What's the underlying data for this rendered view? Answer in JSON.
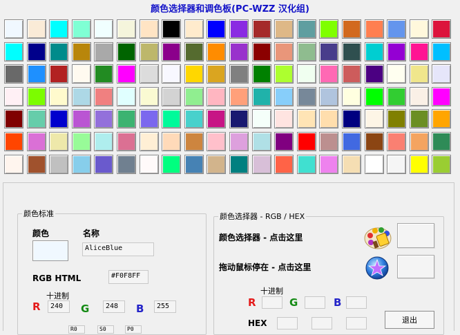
{
  "title": "颜色选择器和调色板(PC-WZZ 汉化组)",
  "palette_rows": [
    [
      "#F0F8FF",
      "#FAEBD7",
      "#00FFFF",
      "#7FFFD4",
      "#F0FFFF",
      "#F5F5DC",
      "#FFE4C4",
      "#000000",
      "#FFEBCD",
      "#0000FF",
      "#8A2BE2",
      "#A52A2A",
      "#DEB887",
      "#5F9EA0",
      "#7FFF00",
      "#D2691E",
      "#FF7F50",
      "#6495ED",
      "#FFF8DC",
      "#DC143C"
    ],
    [
      "#00FFFF",
      "#00008B",
      "#008B8B",
      "#B8860B",
      "#A9A9A9",
      "#006400",
      "#BDB76B",
      "#8B008B",
      "#556B2F",
      "#FF8C00",
      "#9932CC",
      "#8B0000",
      "#E9967A",
      "#8FBC8F",
      "#483D8B",
      "#2F4F4F",
      "#00CED1",
      "#9400D3",
      "#FF1493",
      "#00BFFF"
    ],
    [
      "#696969",
      "#1E90FF",
      "#B22222",
      "#FFFAF0",
      "#228B22",
      "#FF00FF",
      "#DCDCDC",
      "#F8F8FF",
      "#FFD700",
      "#DAA520",
      "#808080",
      "#008000",
      "#ADFF2F",
      "#F0FFF0",
      "#FF69B4",
      "#CD5C5C",
      "#4B0082",
      "#FFFFF0",
      "#F0E68C",
      "#E6E6FA"
    ],
    [
      "#FFF0F5",
      "#7CFC00",
      "#FFFACD",
      "#ADD8E6",
      "#F08080",
      "#E0FFFF",
      "#FAFAD2",
      "#D3D3D3",
      "#90EE90",
      "#FFB6C1",
      "#FFA07A",
      "#20B2AA",
      "#87CEFA",
      "#778899",
      "#B0C4DE",
      "#FFFFE0",
      "#00FF00",
      "#32CD32",
      "#FAF0E6",
      "#FF00FF"
    ],
    [
      "#800000",
      "#66CDAA",
      "#0000CD",
      "#BA55D3",
      "#9370DB",
      "#3CB371",
      "#7B68EE",
      "#00FA9A",
      "#48D1CC",
      "#C71585",
      "#191970",
      "#F5FFFA",
      "#FFE4E1",
      "#FFE4B5",
      "#FFDEAD",
      "#000080",
      "#FDF5E6",
      "#808000",
      "#6B8E23",
      "#FFA500"
    ],
    [
      "#FF4500",
      "#DA70D6",
      "#EEE8AA",
      "#98FB98",
      "#AFEEEE",
      "#DB7093",
      "#FFEFD5",
      "#FFDAB9",
      "#CD853F",
      "#FFC0CB",
      "#DDA0DD",
      "#B0E0E6",
      "#800080",
      "#FF0000",
      "#BC8F8F",
      "#4169E1",
      "#8B4513",
      "#FA8072",
      "#F4A460",
      "#2E8B57"
    ],
    [
      "#FFF5EE",
      "#A0522D",
      "#C0C0C0",
      "#87CEEB",
      "#6A5ACD",
      "#708090",
      "#FFFAFA",
      "#00FF7F",
      "#4682B4",
      "#D2B48C",
      "#008080",
      "#D8BFD8",
      "#FF6347",
      "#40E0D0",
      "#EE82EE",
      "#F5DEB3",
      "#FFFFFF",
      "#F5F5F5",
      "#FFFF00",
      "#9ACD32"
    ]
  ],
  "left_group": {
    "legend": "颜色标准",
    "color_label": "颜色",
    "name_label": "名称",
    "current_color": "#F0F8FF",
    "name_value": "AliceBlue",
    "rgb_html_label": "RGB HTML",
    "rgb_html_value": "#F0F8FF",
    "decimal_label": "十进制",
    "r_label": "R",
    "r_value": "240",
    "g_label": "G",
    "g_value": "248",
    "b_label": "B",
    "b_value": "255",
    "bottom_values": [
      "R0",
      "S0",
      "P0"
    ]
  },
  "right_group": {
    "legend": "颜色选择器 - RGB / HEX",
    "picker_label": "颜色选择器 - 点击这里",
    "drag_label": "拖动鼠标停在 - 点击这里",
    "decimal_label": "十进制",
    "r_label": "R",
    "g_label": "G",
    "b_label": "B",
    "hex_label": "HEX",
    "exit_label": "退出"
  },
  "icons": {
    "picker_icon": "paint-palette-icon",
    "drag_icon": "star-orb-icon"
  },
  "colors": {
    "title": "#1212C8",
    "r": "#E41A1A",
    "g": "#138A13",
    "b": "#2323C8"
  }
}
